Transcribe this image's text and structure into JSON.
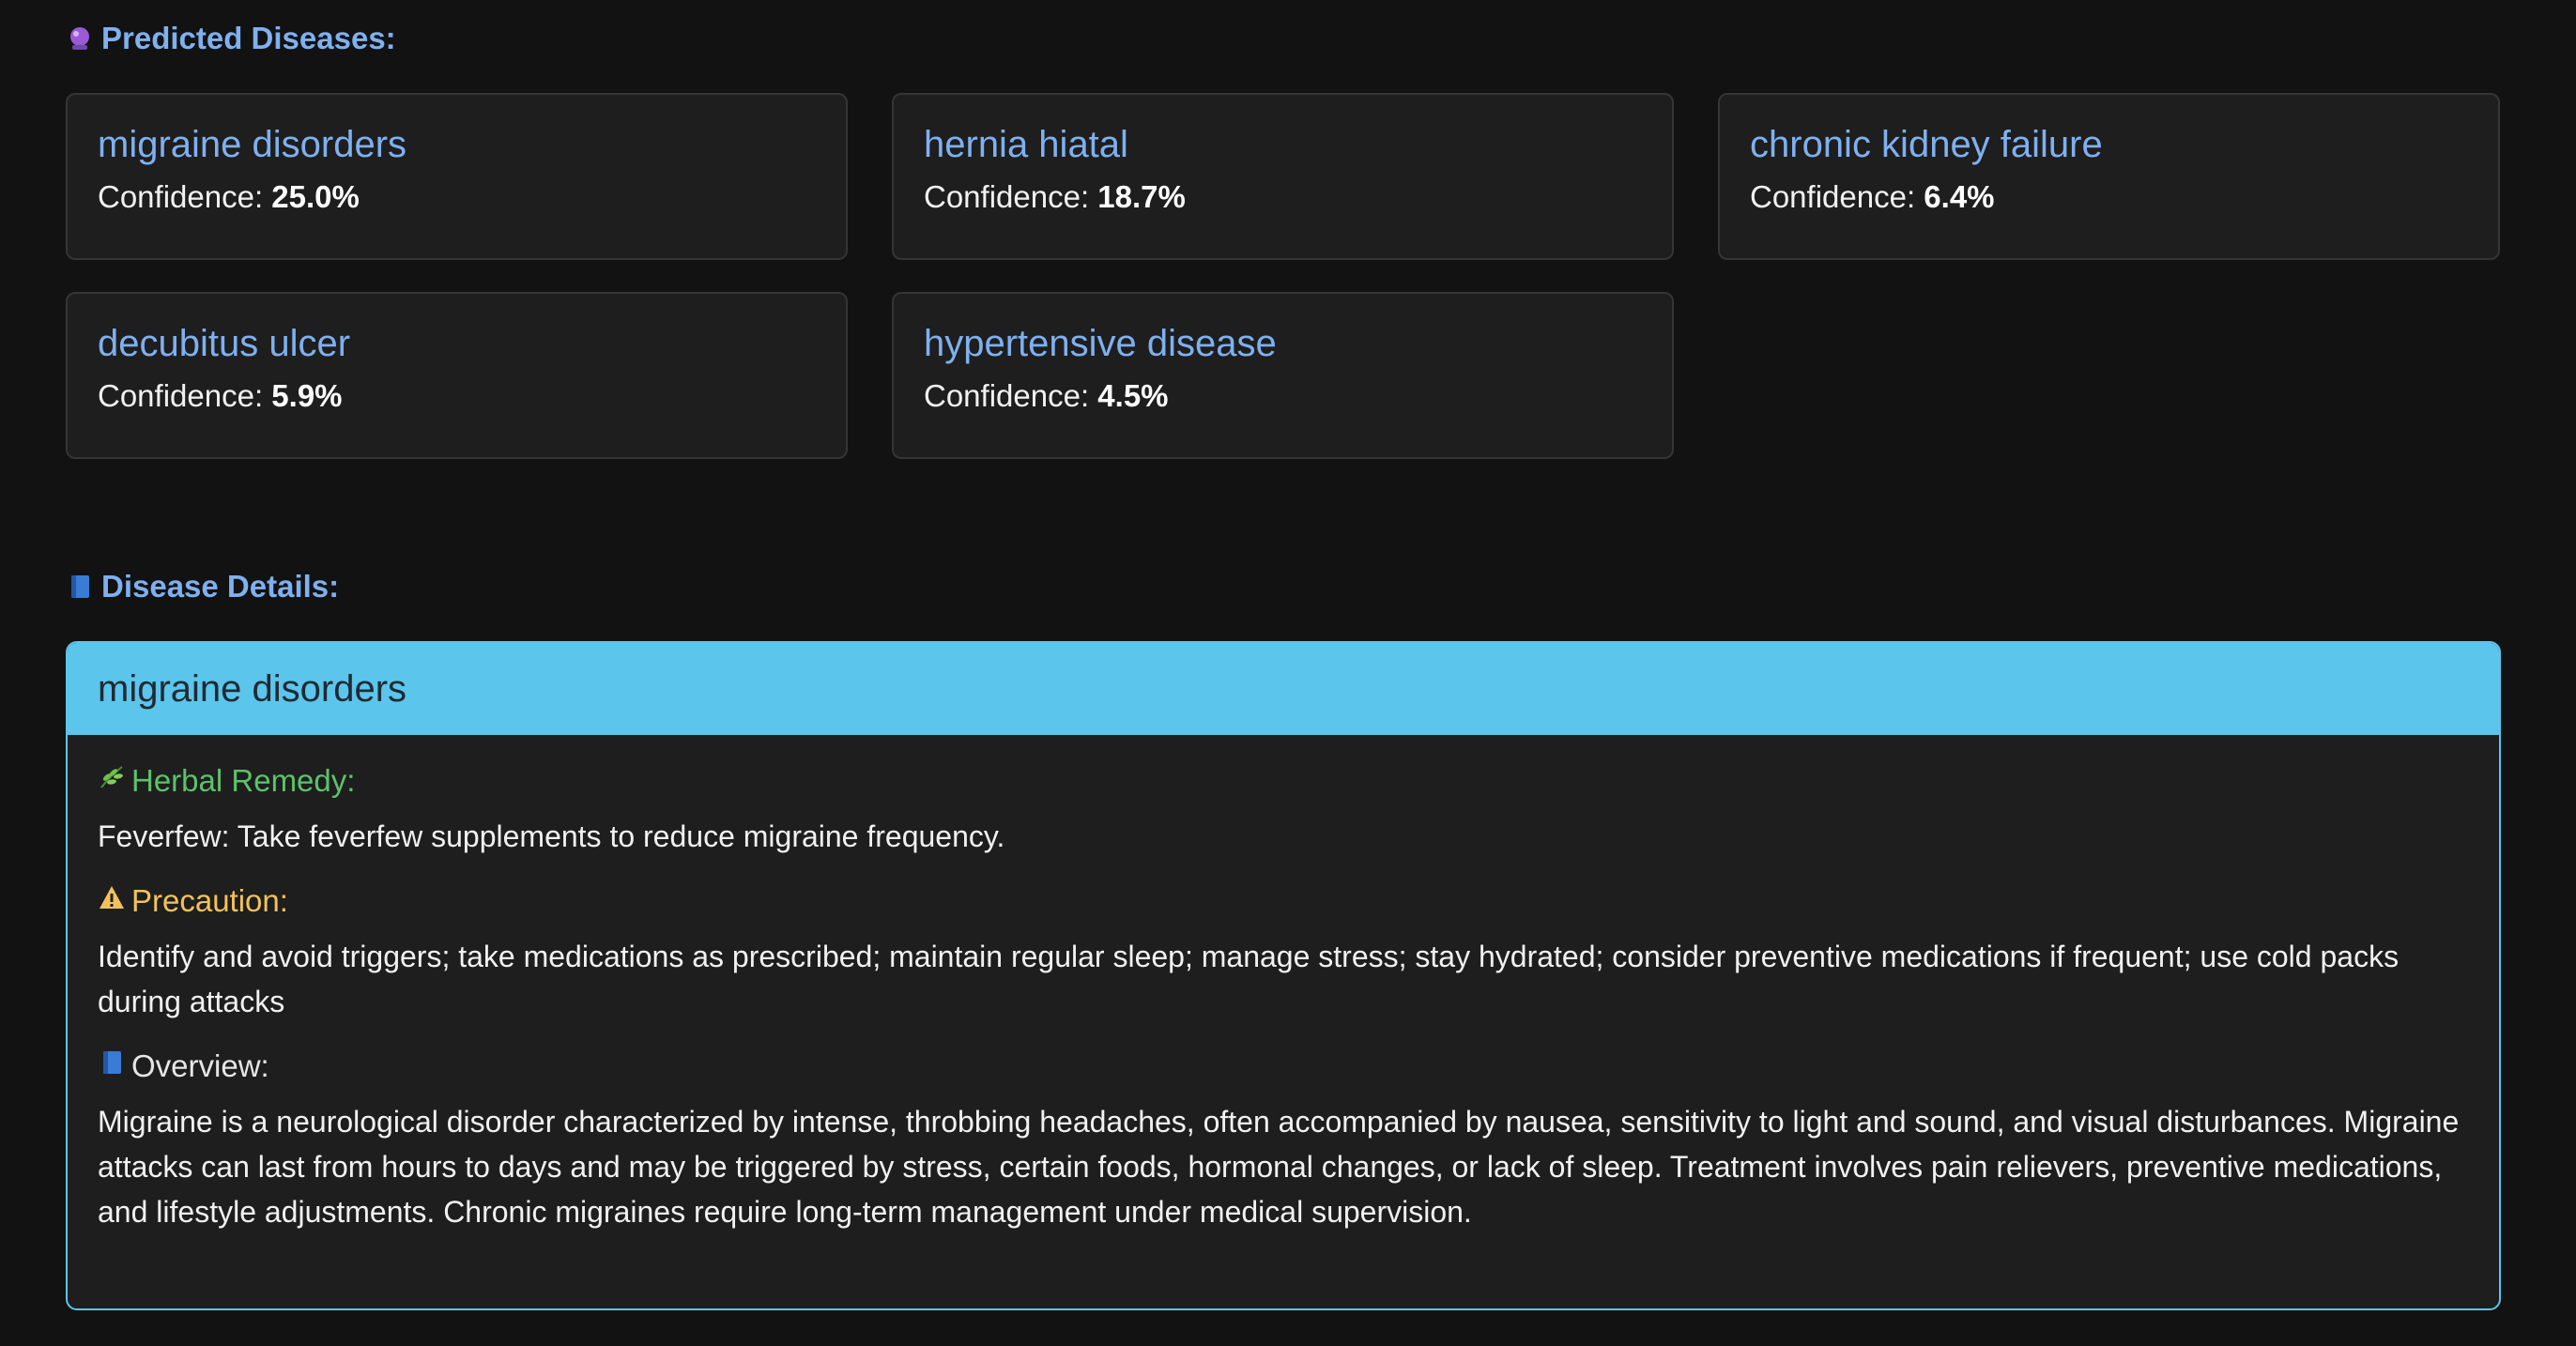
{
  "predicted": {
    "heading": "Predicted Diseases:",
    "icon": "crystal-ball-icon",
    "confidence_label": "Confidence:",
    "items": [
      {
        "name": "migraine disorders",
        "confidence": "25.0%"
      },
      {
        "name": "hernia hiatal",
        "confidence": "18.7%"
      },
      {
        "name": "chronic kidney failure",
        "confidence": "6.4%"
      },
      {
        "name": "decubitus ulcer",
        "confidence": "5.9%"
      },
      {
        "name": "hypertensive disease",
        "confidence": "4.5%"
      }
    ]
  },
  "details": {
    "heading": "Disease Details:",
    "icon": "book-icon",
    "disease": "migraine disorders",
    "herbal_label": "Herbal Remedy:",
    "herbal_icon": "herb-icon",
    "herbal_text": "Feverfew: Take feverfew supplements to reduce migraine frequency.",
    "precaution_label": "Precaution:",
    "precaution_icon": "warning-icon",
    "precaution_text": "Identify and avoid triggers; take medications as prescribed; maintain regular sleep; manage stress; stay hydrated; consider preventive medications if frequent; use cold packs during attacks",
    "overview_label": "Overview:",
    "overview_icon": "book-icon",
    "overview_text": "Migraine is a neurological disorder characterized by intense, throbbing headaches, often accompanied by nausea, sensitivity to light and sound, and visual disturbances. Migraine attacks can last from hours to days and may be triggered by stress, certain foods, hormonal changes, or lack of sleep. Treatment involves pain relievers, preventive medications, and lifestyle adjustments. Chronic migraines require long-term management under medical supervision."
  },
  "colors": {
    "background": "#121212",
    "card_background": "#1e1e1e",
    "accent_blue": "#7fb0ef",
    "header_cyan": "#5bc5eb",
    "herbal_green": "#5cc26a",
    "precaution_yellow": "#f2c25a"
  }
}
